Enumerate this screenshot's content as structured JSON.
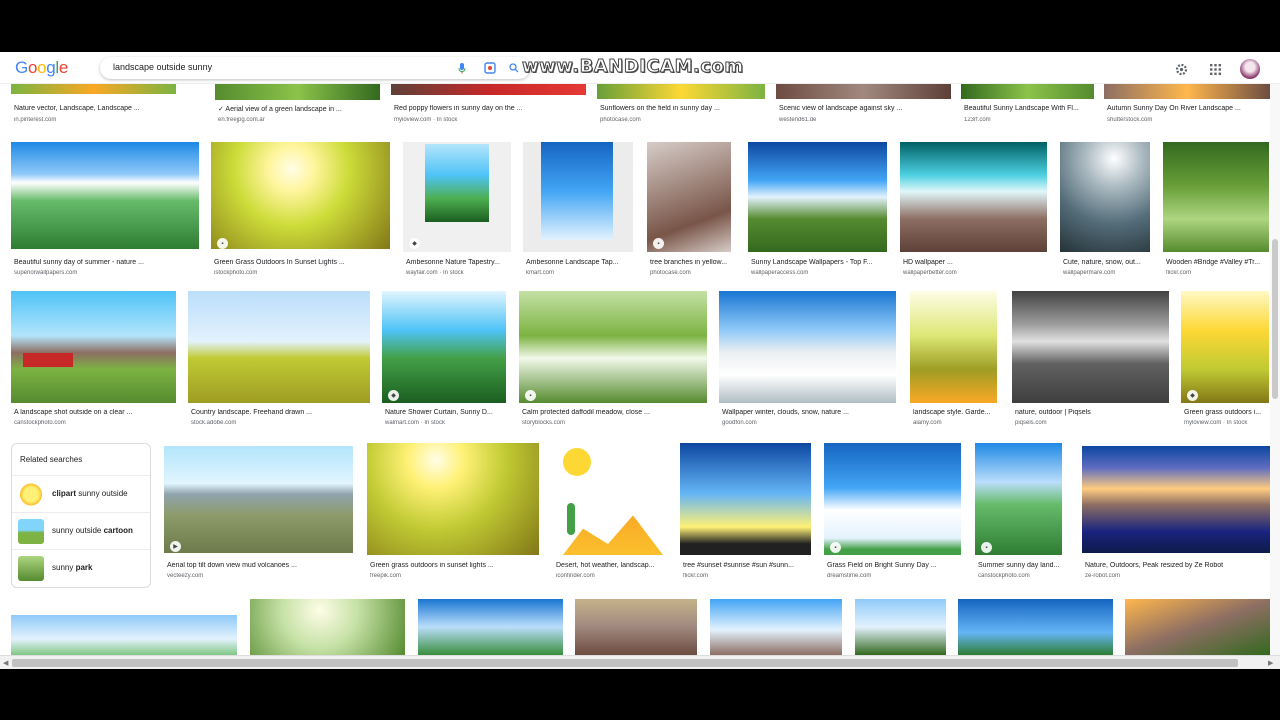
{
  "search": {
    "query": "landscape outside sunny"
  },
  "watermark": "www.BANDICAM.com",
  "logo": [
    "G",
    "o",
    "o",
    "g",
    "l",
    "e"
  ],
  "logo_colors": [
    "#4285F4",
    "#EA4335",
    "#FBBC05",
    "#4285F4",
    "#34A853",
    "#EA4335"
  ],
  "row0": [
    {
      "cap": "Nature vector, Landscape, Landscape ...",
      "src": "in.pinterest.com"
    },
    {
      "cap": "✓ Aerial view of a green landscape in ...",
      "src": "en.freejpg.com.ar"
    },
    {
      "cap": "Red poppy flowers in sunny day on the ...",
      "src": "myloview.com · In stock"
    },
    {
      "cap": "Sunflowers on the field in sunny day ...",
      "src": "photocase.com"
    },
    {
      "cap": "Scenic view of landscape against sky ...",
      "src": "westend61.de"
    },
    {
      "cap": "Beautiful Sunny Landscape With Fl...",
      "src": "123rf.com"
    },
    {
      "cap": "Autumn Sunny Day On River Landscape ...",
      "src": "shutterstock.com"
    }
  ],
  "row1": [
    {
      "cap": "Beautiful sunny day of summer - nature ...",
      "src": "superiorwallpapers.com"
    },
    {
      "cap": "Green Grass Outdoors In Sunset Lights ...",
      "src": "istockphoto.com"
    },
    {
      "cap": "Ambesonne Nature Tapestry...",
      "src": "wayfair.com · In stock"
    },
    {
      "cap": "Ambesonne Landscape Tap...",
      "src": "kmart.com"
    },
    {
      "cap": "tree branches in yellow...",
      "src": "photocase.com"
    },
    {
      "cap": "Sunny Landscape Wallpapers - Top F...",
      "src": "wallpaperaccess.com"
    },
    {
      "cap": "HD wallpaper ...",
      "src": "wallpaperbetter.com"
    },
    {
      "cap": "Cute, nature, snow, out...",
      "src": "wallpapermare.com"
    },
    {
      "cap": "Wooden #Bridge #Valley #Tr...",
      "src": "flickr.com"
    }
  ],
  "row2": [
    {
      "cap": "A landscape shot outside on a clear ...",
      "src": "canstockphoto.com"
    },
    {
      "cap": "Country landscape. Freehand drawn ...",
      "src": "stock.adobe.com"
    },
    {
      "cap": "Nature Shower Curtain, Sunny D...",
      "src": "walmart.com · In stock"
    },
    {
      "cap": "Calm protected daffodil meadow, close ...",
      "src": "storyblocks.com"
    },
    {
      "cap": "Wallpaper winter, clouds, snow, nature ...",
      "src": "goodfon.com"
    },
    {
      "cap": "landscape style. Garde...",
      "src": "alamy.com"
    },
    {
      "cap": "nature, outdoor | Piqsels",
      "src": "piqsels.com"
    },
    {
      "cap": "Green grass outdoors i...",
      "src": "myloview.com · In stock"
    }
  ],
  "row3": [
    {
      "cap": "Aerial top tilt down view mud volcanoes ...",
      "src": "vecteezy.com"
    },
    {
      "cap": "Green grass outdoors in sunset lights ...",
      "src": "freepik.com"
    },
    {
      "cap": "Desert, hot weather, landscap...",
      "src": "iconfinder.com"
    },
    {
      "cap": "tree #sunset #sunrise #sun #sunn...",
      "src": "flickr.com"
    },
    {
      "cap": "Grass Field on Bright Sunny Day ...",
      "src": "dreamstime.com"
    },
    {
      "cap": "Summer sunny day land...",
      "src": "canstockphoto.com"
    },
    {
      "cap": "Nature, Outdoors, Peak resized by Ze Robot",
      "src": "ze-robot.com"
    }
  ],
  "related": {
    "title": "Related searches",
    "items": [
      {
        "bold": "clipart",
        "rest": " sunny outside",
        "bold_first": true
      },
      {
        "bold": "cartoon",
        "rest": "sunny outside ",
        "bold_first": false
      },
      {
        "bold": "park",
        "rest": "sunny ",
        "bold_first": false
      }
    ]
  }
}
